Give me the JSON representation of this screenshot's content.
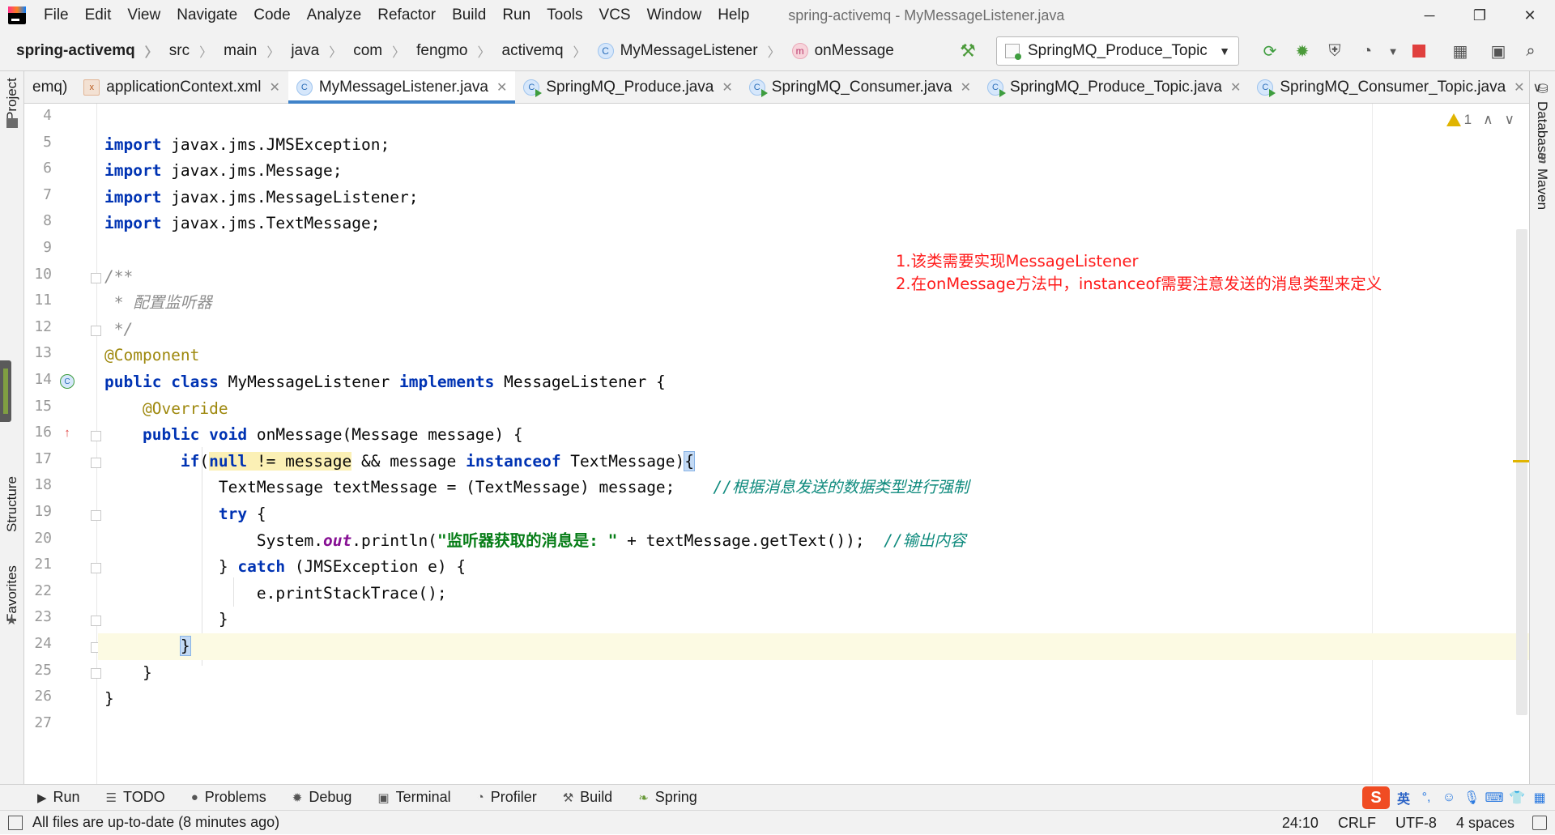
{
  "menubar": {
    "items": [
      "File",
      "Edit",
      "View",
      "Navigate",
      "Code",
      "Analyze",
      "Refactor",
      "Build",
      "Run",
      "Tools",
      "VCS",
      "Window",
      "Help"
    ],
    "title": "spring-activemq - MyMessageListener.java"
  },
  "window_controls": {
    "minimize": "─",
    "restore": "❐",
    "close": "✕"
  },
  "breadcrumbs": [
    "spring-activemq",
    "src",
    "main",
    "java",
    "com",
    "fengmo",
    "activemq",
    "MyMessageListener",
    "onMessage"
  ],
  "run_config": {
    "name": "SpringMQ_Produce_Topic"
  },
  "tabs": [
    {
      "label": "emq)",
      "icon": "none"
    },
    {
      "label": "applicationContext.xml",
      "icon": "xml-icon"
    },
    {
      "label": "MyMessageListener.java",
      "icon": "class-icon",
      "active": true
    },
    {
      "label": "SpringMQ_Produce.java",
      "icon": "runnable-class-icon"
    },
    {
      "label": "SpringMQ_Consumer.java",
      "icon": "runnable-class-icon"
    },
    {
      "label": "SpringMQ_Produce_Topic.java",
      "icon": "runnable-class-icon"
    },
    {
      "label": "SpringMQ_Consumer_Topic.java",
      "icon": "runnable-class-icon"
    }
  ],
  "left_tool_windows": [
    "Project",
    "Structure",
    "Favorites"
  ],
  "right_tool_windows": [
    "Database",
    "Maven"
  ],
  "inspections": {
    "warning_count": "1"
  },
  "editor": {
    "line_numbers": [
      "4",
      "5",
      "6",
      "7",
      "8",
      "9",
      "10",
      "11",
      "12",
      "13",
      "14",
      "15",
      "16",
      "17",
      "18",
      "19",
      "20",
      "21",
      "22",
      "23",
      "24",
      "25",
      "26",
      "27"
    ],
    "current_line": "24"
  },
  "code": {
    "import": "import",
    "imp1": " javax.jms.JMSException;",
    "imp2": " javax.jms.Message;",
    "imp3": " javax.jms.MessageListener;",
    "imp4": " javax.jms.TextMessage;",
    "doc_open": "/**",
    "doc_body": " * 配置监听器",
    "doc_close": " */",
    "annotation_component": "@Component",
    "kw_public": "public",
    "kw_class": "class",
    "class_name": " MyMessageListener ",
    "kw_implements": "implements",
    "iface": " MessageListener {",
    "annotation_override": "@Override",
    "kw_void": "void",
    "method_sig": " onMessage(Message message) {",
    "kw_if": "if",
    "paren_open": "(",
    "kw_null": "null",
    "null_cmp": " != message",
    "and_part": " && message ",
    "kw_instanceof": "instanceof",
    "if_tail": " TextMessage)",
    "brace_open": "{",
    "cast_line": "TextMessage textMessage = (TextMessage) message;    ",
    "cast_comment": "//根据消息发送的数据类型进行强制",
    "kw_try": "try",
    "try_tail": " {",
    "sys_prefix": "System.",
    "sys_out": "out",
    "println": ".println(",
    "str_literal": "\"监听器获取的消息是: \"",
    "println_tail": " + textMessage.getText());  ",
    "println_comment": "//输出内容",
    "catch_head": "} ",
    "kw_catch": "catch",
    "catch_tail": " (JMSException e) {",
    "stack_trace": "e.printStackTrace();",
    "close_brace": "}",
    "brace_close": "}"
  },
  "notes": {
    "line1": "1.该类需要实现MessageListener",
    "line2": "2.在onMessage方法中，instanceof需要注意发送的消息类型来定义"
  },
  "tool_tabs": [
    {
      "label": "Run",
      "icon": "run-icon"
    },
    {
      "label": "TODO",
      "icon": "todo-icon"
    },
    {
      "label": "Problems",
      "icon": "problems-icon"
    },
    {
      "label": "Debug",
      "icon": "debug-icon"
    },
    {
      "label": "Terminal",
      "icon": "terminal-icon"
    },
    {
      "label": "Profiler",
      "icon": "profiler-icon"
    },
    {
      "label": "Build",
      "icon": "build-icon"
    },
    {
      "label": "Spring",
      "icon": "spring-icon"
    }
  ],
  "ime": {
    "logo": "S",
    "lang": "英"
  },
  "status": {
    "message": "All files are up-to-date (8 minutes ago)",
    "position": "24:10",
    "line_sep": "CRLF",
    "encoding": "UTF-8",
    "indent": "4 spaces"
  },
  "colors": {
    "keyword": "#0033b3",
    "annotation": "#9e880d",
    "comment": "#0e8a7d",
    "string": "#067d17",
    "note_red": "#ff1a1a",
    "active_tab_underline": "#4083c9"
  }
}
